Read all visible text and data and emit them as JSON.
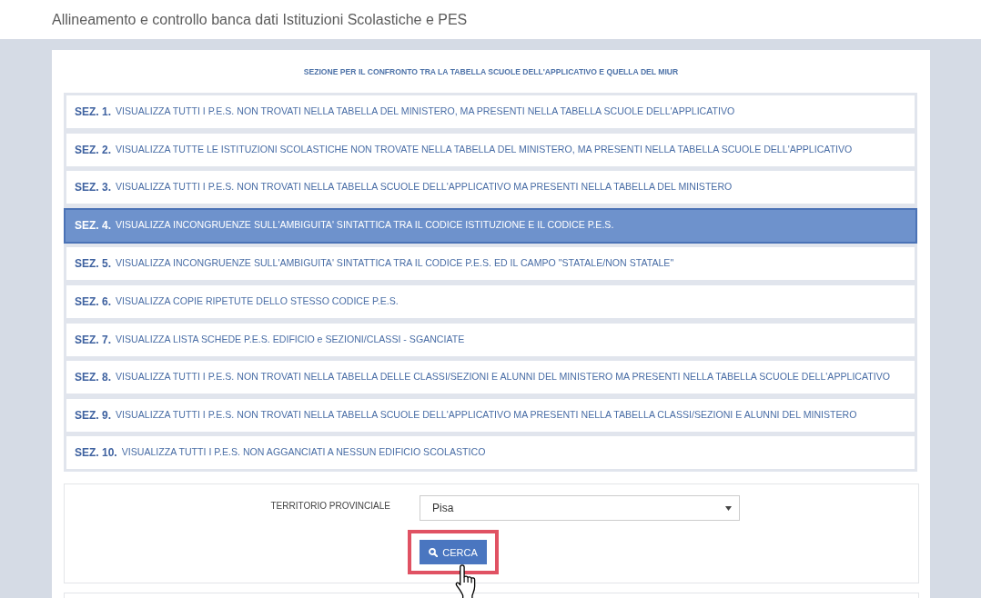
{
  "page_title": "Allineamento e controllo banca dati Istituzioni Scolastiche e PES",
  "panel": {
    "heading": "SEZIONE PER IL CONFRONTO TRA LA TABELLA SCUOLE DELL'APPLICATIVO E QUELLA DEL MIUR",
    "sections": [
      {
        "code": "SEZ. 1.",
        "text": "VISUALIZZA TUTTI I P.E.S. NON TROVATI NELLA TABELLA DEL MINISTERO, MA PRESENTI NELLA TABELLA SCUOLE DELL'APPLICATIVO",
        "selected": false
      },
      {
        "code": "SEZ. 2.",
        "text": "VISUALIZZA TUTTE LE ISTITUZIONI SCOLASTICHE NON TROVATE NELLA TABELLA DEL MINISTERO, MA PRESENTI NELLA TABELLA SCUOLE DELL'APPLICATIVO",
        "selected": false
      },
      {
        "code": "SEZ. 3.",
        "text": "VISUALIZZA TUTTI I P.E.S. NON TROVATI NELLA TABELLA SCUOLE DELL'APPLICATIVO MA PRESENTI NELLA TABELLA DEL MINISTERO",
        "selected": false
      },
      {
        "code": "SEZ. 4.",
        "text": "VISUALIZZA INCONGRUENZE SULL'AMBIGUITA' SINTATTICA TRA IL CODICE ISTITUZIONE E IL CODICE P.E.S.",
        "selected": true
      },
      {
        "code": "SEZ. 5.",
        "text": "VISUALIZZA INCONGRUENZE SULL'AMBIGUITA' SINTATTICA TRA IL CODICE P.E.S. ED IL CAMPO \"STATALE/NON STATALE\"",
        "selected": false
      },
      {
        "code": "SEZ. 6.",
        "text": "VISUALIZZA COPIE RIPETUTE DELLO STESSO CODICE P.E.S.",
        "selected": false
      },
      {
        "code": "SEZ. 7.",
        "text": "VISUALIZZA LISTA SCHEDE P.E.S. EDIFICIO e SEZIONI/CLASSI - SGANCIATE",
        "selected": false
      },
      {
        "code": "SEZ. 8.",
        "text": "VISUALIZZA TUTTI I P.E.S. NON TROVATI NELLA TABELLA DELLE CLASSI/SEZIONI E ALUNNI DEL MINISTERO MA PRESENTI NELLA TABELLA SCUOLE DELL'APPLICATIVO",
        "selected": false
      },
      {
        "code": "SEZ. 9.",
        "text": "VISUALIZZA TUTTI I P.E.S. NON TROVATI NELLA TABELLA SCUOLE DELL'APPLICATIVO MA PRESENTI NELLA TABELLA CLASSI/SEZIONI E ALUNNI DEL MINISTERO",
        "selected": false
      },
      {
        "code": "SEZ. 10.",
        "text": "VISUALIZZA TUTTI I P.E.S. NON AGGANCIATI A NESSUN EDIFICIO SCOLASTICO",
        "selected": false
      }
    ]
  },
  "filter": {
    "label": "TERRITORIO PROVINCIALE",
    "select_value": "Pisa",
    "search_button": {
      "label": "CERCA",
      "highlighted": true,
      "hovered": true
    }
  }
}
